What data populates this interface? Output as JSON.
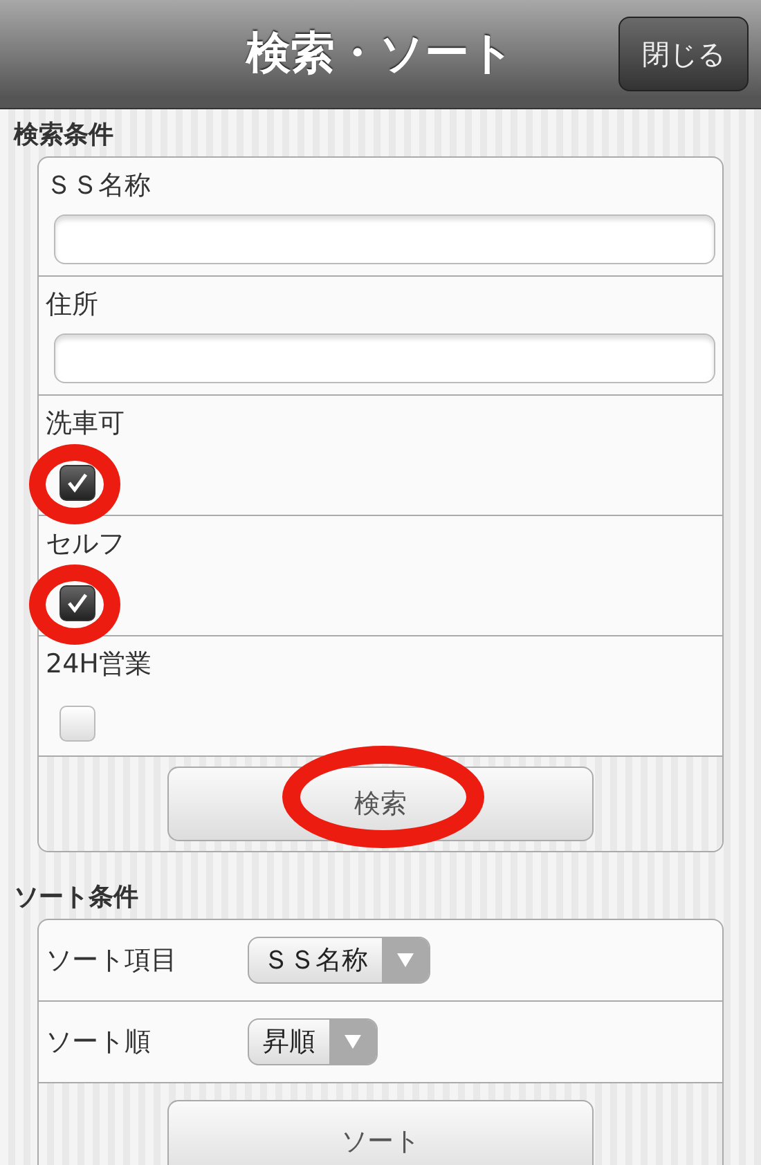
{
  "header": {
    "title": "検索・ソート",
    "close_button": "閉じる"
  },
  "search_section": {
    "heading": "検索条件",
    "fields": [
      {
        "kind": "text",
        "label": "ＳＳ名称"
      },
      {
        "kind": "text",
        "label": "住所"
      },
      {
        "kind": "checkbox",
        "label": "洗車可",
        "checked": true,
        "highlighted": true
      },
      {
        "kind": "checkbox",
        "label": "セルフ",
        "checked": true,
        "highlighted": true
      },
      {
        "kind": "checkbox",
        "label": "24H営業",
        "checked": false,
        "highlighted": false
      }
    ],
    "button": {
      "label": "検索",
      "highlighted": true
    }
  },
  "sort_section": {
    "heading": "ソート条件",
    "rows": [
      {
        "label": "ソート項目",
        "value": "ＳＳ名称"
      },
      {
        "label": "ソート順",
        "value": "昇順"
      }
    ],
    "button": {
      "label": "ソート",
      "highlighted": false
    }
  }
}
